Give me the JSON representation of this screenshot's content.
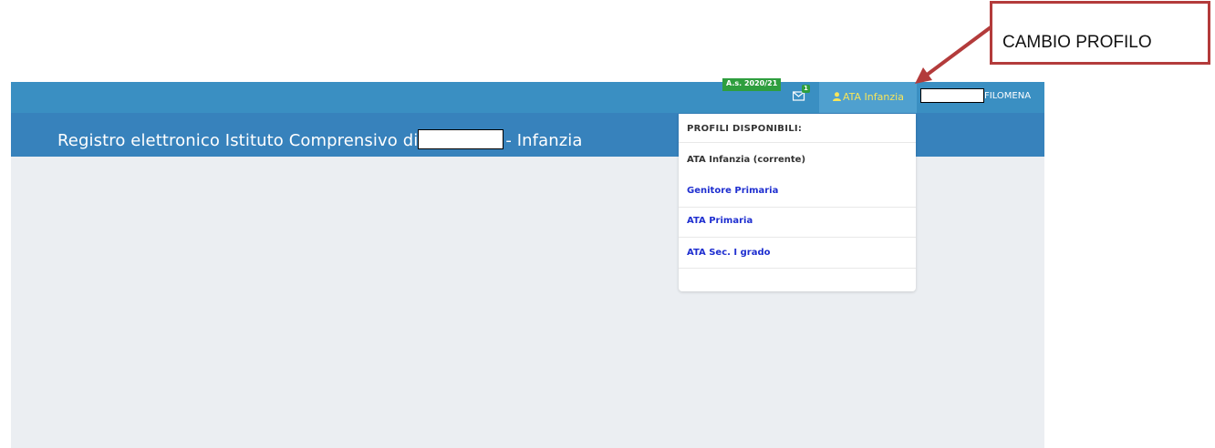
{
  "header": {
    "school_year_badge": "A.s. 2020/21",
    "mail_count": "1",
    "profile_label": "ATA Infanzia",
    "user_name": "FILOMENA"
  },
  "page": {
    "title_prefix": "Registro elettronico Istituto Comprensivo di",
    "title_suffix": "- Infanzia"
  },
  "profile_menu": {
    "header": "PROFILI DISPONIBILI:",
    "current": "ATA Infanzia (corrente)",
    "items": [
      "Genitore Primaria",
      "ATA Primaria",
      "ATA Sec. I grado"
    ]
  },
  "callout": {
    "text": "CAMBIO PROFILO",
    "color": "#b33b3b"
  },
  "icons": [
    "mail-icon",
    "user-icon"
  ],
  "colors": {
    "topbar": "#3a8fc2",
    "titlebar": "#3782bc",
    "accent_link": "#1f2fd0",
    "badge": "#2e9e3e"
  }
}
